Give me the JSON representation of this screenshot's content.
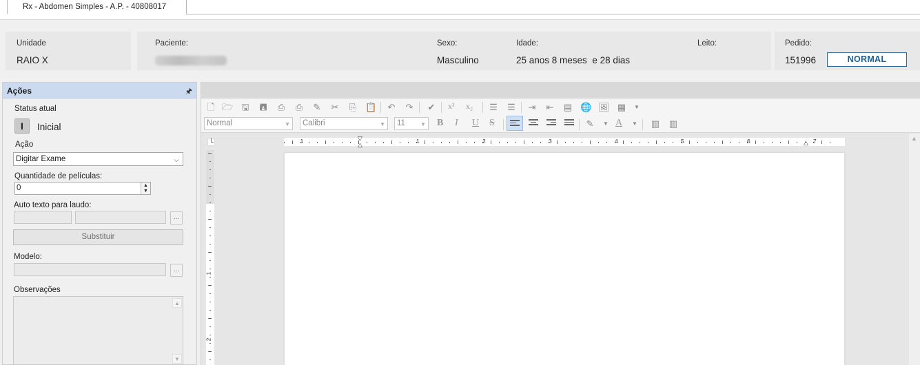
{
  "tab": {
    "label": "Rx - Abdomen Simples - A.P. - 40808017"
  },
  "header": {
    "unidade_label": "Unidade",
    "unidade_value": "RAIO X",
    "paciente_label": "Paciente:",
    "sexo_label": "Sexo:",
    "sexo_value": "Masculino",
    "idade_label": "Idade:",
    "idade_value": "25 anos 8 meses  e 28 dias",
    "leito_label": "Leito:",
    "pedido_label": "Pedido:",
    "pedido_value": "151996",
    "prioridade": "NORMAL"
  },
  "acoes": {
    "title": "Ações",
    "status_label": "Status atual",
    "status_code": "I",
    "status_value": "Inicial",
    "acao_label": "Ação",
    "acao_value": "Digitar Exame",
    "quantidade_label": "Quantidade de películas:",
    "quantidade_value": "0",
    "auto_texto_label": "Auto texto para laudo:",
    "ellipsis": "...",
    "substituir_label": "Substituir",
    "modelo_label": "Modelo:",
    "observacoes_label": "Observações"
  },
  "editor": {
    "style_value": "Normal",
    "font_value": "Calibri",
    "size_value": "11",
    "ruler_numbers": [
      "1",
      "1",
      "2",
      "3",
      "4",
      "5",
      "6",
      "7"
    ],
    "vruler_numbers": [
      "1",
      "2"
    ]
  },
  "colors": {
    "accent": "#1d5f91",
    "panel_header": "#ccdaf0"
  }
}
